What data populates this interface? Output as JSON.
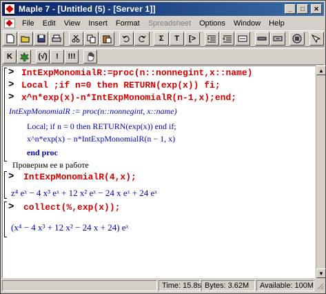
{
  "window": {
    "title": "Maple 7 - [Untitled (5) - [Server 1]]"
  },
  "menu": [
    {
      "label": "File",
      "disabled": false
    },
    {
      "label": "Edit",
      "disabled": false
    },
    {
      "label": "View",
      "disabled": false
    },
    {
      "label": "Insert",
      "disabled": false
    },
    {
      "label": "Format",
      "disabled": false
    },
    {
      "label": "Spreadsheet",
      "disabled": true
    },
    {
      "label": "Options",
      "disabled": false
    },
    {
      "label": "Window",
      "disabled": false
    },
    {
      "label": "Help",
      "disabled": false
    }
  ],
  "toolbar1": {
    "sigma_label": "Σ",
    "text_label": "T",
    "bracket_label": "[>"
  },
  "toolbar2": {
    "k_label": "K",
    "restart_label": "(√)",
    "exclaim_label": "!",
    "double_exclaim_label": "!!!"
  },
  "worksheet": {
    "cmd1_line1": "IntExpMonomialR:=proc(n::nonnegint,x::name)",
    "cmd1_line2": "Local  ;if n=0 then RETURN(exp(x)) fi;",
    "cmd1_line3": "x^n*exp(x)-n*IntExpMonomialR(n-1,x);end;",
    "out1_line1": "IntExpMonomialR := proc(n::nonnegint, x::name)",
    "out1_line2": "Local; if n = 0 then RETURN(exp(x)) end if;",
    "out1_line3": "x^n*exp(x) − n*IntExpMonomialR(n − 1, x)",
    "out1_line4": "end proc",
    "text1": "Проверим ее в работе",
    "cmd2": "IntExpMonomialR(4,x);",
    "out2": "z⁴ eˣ − 4 x³ eˣ + 12 x² eˣ − 24 x eˣ + 24 eˣ",
    "cmd3": "collect(%,exp(x));",
    "out3": "(x⁴ − 4 x³ + 12 x² − 24 x + 24) eˣ",
    "prompt": ">"
  },
  "status": {
    "time": "Time: 15.8s",
    "bytes": "Bytes: 3.62M",
    "available": "Available: 100M"
  }
}
